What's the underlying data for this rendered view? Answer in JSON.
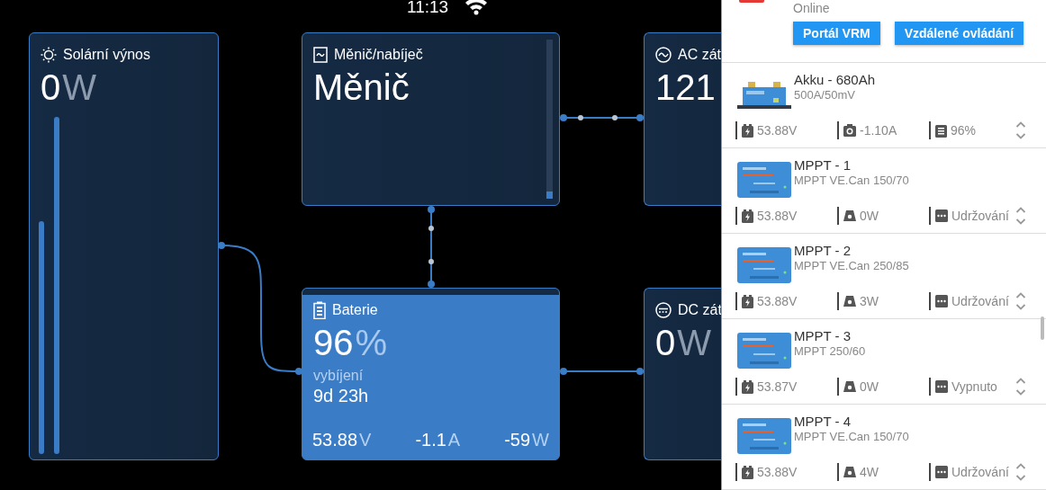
{
  "status_bar": {
    "time": "11:13"
  },
  "tiles": [
    {
      "kind": "solar",
      "title": "Solární výnos",
      "value": "0",
      "unit": "W",
      "bars": [
        {
          "level": 0.69
        },
        {
          "level": 1.0
        }
      ]
    },
    {
      "kind": "inverter",
      "title": "Měnič/nabíječ",
      "value": "Měnič"
    },
    {
      "kind": "ac",
      "title": "AC zát",
      "value": "121"
    },
    {
      "kind": "battery",
      "title": "Baterie",
      "value": "96",
      "unit": "%",
      "mode": "vybíjení",
      "time": "9d 23h",
      "readings": [
        {
          "value": "53.88",
          "unit": "V"
        },
        {
          "value": "-1.1",
          "unit": "A"
        },
        {
          "value": "-59",
          "unit": "W"
        }
      ]
    },
    {
      "kind": "dc",
      "title": "DC zát",
      "value": "0",
      "unit": "W"
    }
  ],
  "panel": {
    "status": "Online",
    "buttons": [
      "Portál VRM",
      "Vzdálené ovládání"
    ],
    "devices": [
      {
        "kind": "battery_monitor",
        "name": "Akku - 680Ah",
        "subtitle": "500A/50mV",
        "stats": [
          {
            "kind": "voltage",
            "text": "53.88V"
          },
          {
            "kind": "current",
            "text": "-1.10A"
          },
          {
            "kind": "soc",
            "text": "96%"
          }
        ]
      },
      {
        "kind": "solar_charger",
        "name": "MPPT - 1",
        "subtitle": "MPPT VE.Can 150/70",
        "stats": [
          {
            "kind": "voltage",
            "text": "53.88V"
          },
          {
            "kind": "power",
            "text": "0W"
          },
          {
            "kind": "state",
            "text": "Udržování"
          }
        ]
      },
      {
        "kind": "solar_charger",
        "name": "MPPT - 2",
        "subtitle": "MPPT VE.Can 250/85",
        "stats": [
          {
            "kind": "voltage",
            "text": "53.88V"
          },
          {
            "kind": "power",
            "text": "3W"
          },
          {
            "kind": "state",
            "text": "Udržování"
          }
        ]
      },
      {
        "kind": "solar_charger",
        "name": "MPPT - 3",
        "subtitle": "MPPT 250/60",
        "stats": [
          {
            "kind": "voltage",
            "text": "53.87V"
          },
          {
            "kind": "power",
            "text": "0W"
          },
          {
            "kind": "state",
            "text": "Vypnuto"
          }
        ]
      },
      {
        "kind": "solar_charger",
        "name": "MPPT - 4",
        "subtitle": "MPPT VE.Can 150/70",
        "stats": [
          {
            "kind": "voltage",
            "text": "53.88V"
          },
          {
            "kind": "power",
            "text": "4W"
          },
          {
            "kind": "state",
            "text": "Udržování"
          }
        ]
      }
    ]
  }
}
